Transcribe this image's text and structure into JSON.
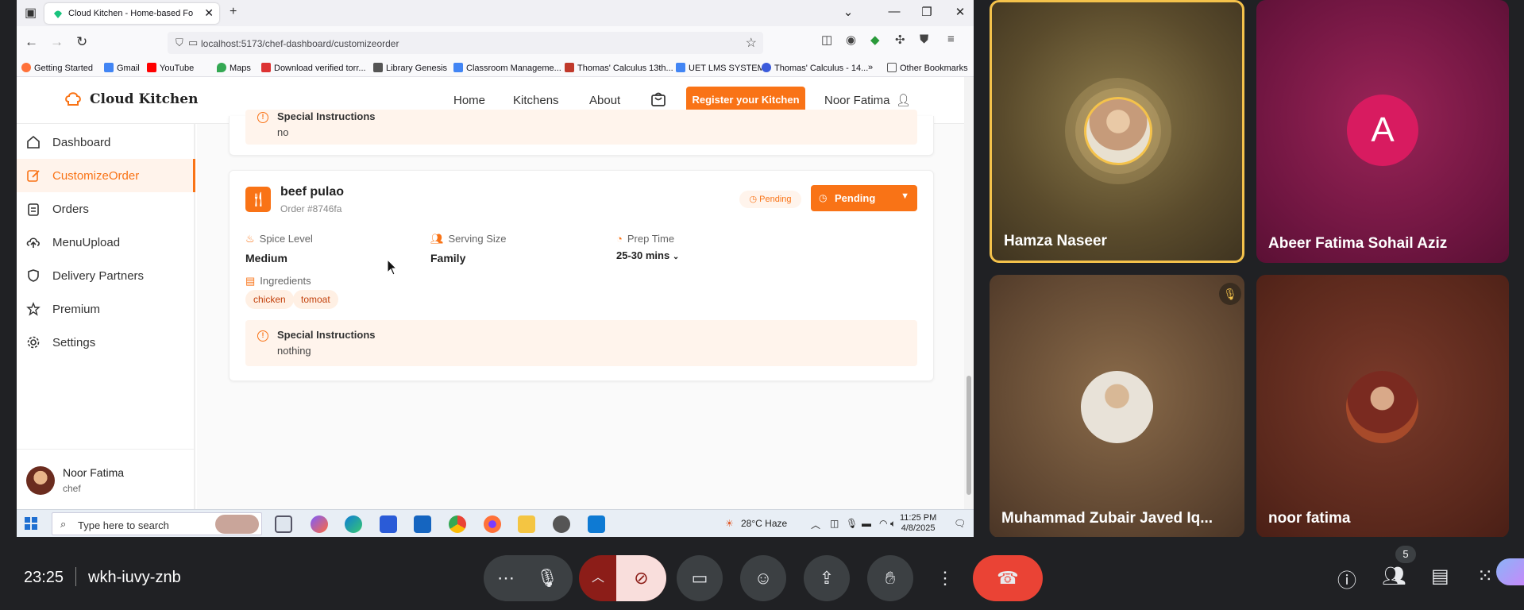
{
  "browser": {
    "tab_title": "Cloud Kitchen - Home-based Fo",
    "url": "localhost:5173/chef-dashboard/customizeorder",
    "bookmarks": [
      "Getting Started",
      "Gmail",
      "YouTube",
      "Maps",
      "Download verified torr...",
      "Library Genesis",
      "Classroom Manageme...",
      "Thomas' Calculus 13th...",
      "UET LMS SYSTEM",
      "Thomas' Calculus - 14...",
      "Other Bookmarks"
    ]
  },
  "app": {
    "brand": "Cloud Kitchen",
    "nav": {
      "home": "Home",
      "kitchens": "Kitchens",
      "about": "About",
      "register": "Register your Kitchen",
      "user": "Noor Fatima"
    },
    "sidebar": [
      {
        "label": "Dashboard",
        "icon": "home-icon"
      },
      {
        "label": "CustomizeOrder",
        "icon": "edit-icon",
        "active": true
      },
      {
        "label": "Orders",
        "icon": "clipboard-icon"
      },
      {
        "label": "MenuUpload",
        "icon": "upload-icon"
      },
      {
        "label": "Delivery Partners",
        "icon": "shield-icon"
      },
      {
        "label": "Premium",
        "icon": "star-icon"
      },
      {
        "label": "Settings",
        "icon": "gear-icon"
      }
    ],
    "profile": {
      "name": "Noor Fatima",
      "role": "chef"
    },
    "prev_card": {
      "special_title": "Special Instructions",
      "special_text": "no"
    },
    "order": {
      "dish": "beef pulao",
      "order_id": "Order #8746fa",
      "status_badge": "Pending",
      "status_select": "Pending",
      "spice_label": "Spice Level",
      "spice_value": "Medium",
      "serving_label": "Serving Size",
      "serving_value": "Family",
      "prep_label": "Prep Time",
      "prep_value": "25-30 mins",
      "ingredients_label": "Ingredients",
      "ingredients": [
        "chicken",
        "tomoat"
      ],
      "special_title": "Special Instructions",
      "special_text": "nothing"
    }
  },
  "taskbar": {
    "search_placeholder": "Type here to search",
    "weather": "28°C  Haze",
    "time": "11:25 PM",
    "date": "4/8/2025"
  },
  "meet": {
    "participants": [
      {
        "name": "Hamza Naseer"
      },
      {
        "name": "Abeer Fatima Sohail Aziz",
        "initial": "A"
      },
      {
        "name": "Muhammad Zubair Javed Iq..."
      },
      {
        "name": "noor fatima"
      }
    ],
    "time": "23:25",
    "meeting_code": "wkh-iuvy-znb",
    "people_count": "5"
  },
  "colors": {
    "accent": "#f97316",
    "meet_bg": "#202124",
    "end_call": "#ea4335"
  }
}
